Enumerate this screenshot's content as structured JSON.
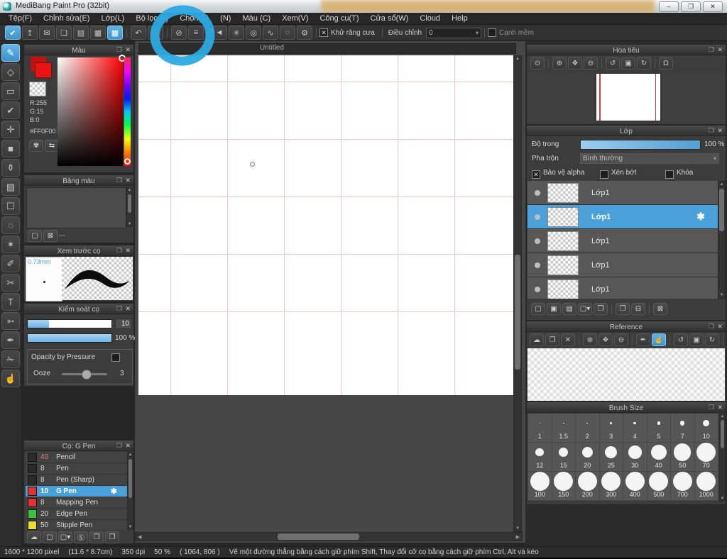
{
  "window": {
    "title": "MediBang Paint Pro (32bit)",
    "controls": [
      "minimize",
      "restore",
      "close-window"
    ]
  },
  "menu": {
    "items": [
      "Tệp(F)",
      "Chỉnh sửa(E)",
      "Lớp(L)",
      "Bộ lọc(R)",
      "Chọn(S)",
      "(N)",
      "Màu (C)",
      "Xem(V)",
      "Công cụ(T)",
      "Cửa sổ(W)",
      "Cloud",
      "Help"
    ]
  },
  "toolbar": {
    "items": [
      {
        "name": "cloud-check",
        "active": true
      },
      "upload",
      "comment",
      "chat",
      "document",
      "list-edit",
      {
        "name": "grid-edit",
        "active": true
      },
      "|",
      "undo",
      "redo",
      "|",
      "no-snap",
      "parallel-snap",
      "|",
      "cross-snap",
      "radial-snap",
      "circle-snap",
      "curve-snap",
      "ellipse-snap",
      "snap-settings"
    ],
    "antialias_label": "Khử răng cưa",
    "adjust_label": "Điều chỉnh",
    "adjust_value": "0",
    "soft_edge_label": "Cạnh mềm"
  },
  "toolbox": {
    "tools": [
      {
        "name": "brush",
        "active": true
      },
      "eraser",
      "shape",
      "polyline",
      "move",
      "fill",
      "bucket",
      "gradient",
      "select",
      "lasso",
      "magic-wand",
      "select-pen",
      "select-eraser",
      "text",
      "operate",
      "eyedropper",
      "div",
      "hand"
    ]
  },
  "color_panel": {
    "title": "Màu",
    "r": "R:255",
    "g": "G:15",
    "b": "B:0",
    "hex": "#FF0F00",
    "buttons": [
      "palette",
      "swap"
    ]
  },
  "palette_panel": {
    "title": "Bảng màu",
    "footer_buttons": [
      "new-item",
      "trash"
    ],
    "footer_text": "---"
  },
  "brush_preview_panel": {
    "title": "Xem trước cọ",
    "size_label": "0.73mm"
  },
  "brush_control_panel": {
    "title": "Kiểm soát cọ",
    "size_value": "10",
    "opacity_value": "100 %",
    "pressure_label": "Opacity by Pressure",
    "ooze_label": "Ooze",
    "ooze_value": "3"
  },
  "brush_list_panel": {
    "title": "Cọ: G Pen",
    "brushes": [
      {
        "size": "40",
        "name": "Pencil",
        "swatch": "#2a2a2a",
        "num_color": "#e57d7d"
      },
      {
        "size": "8",
        "name": "Pen",
        "swatch": "#2a2a2a"
      },
      {
        "size": "8",
        "name": "Pen (Sharp)",
        "swatch": "#2a2a2a"
      },
      {
        "size": "10",
        "name": "G Pen",
        "swatch": "#e23131",
        "selected": true
      },
      {
        "size": "8",
        "name": "Mapping Pen",
        "swatch": "#e23131"
      },
      {
        "size": "20",
        "name": "Edge Pen",
        "swatch": "#35c435"
      },
      {
        "size": "50",
        "name": "Stipple Pen",
        "swatch": "#e8e02c"
      }
    ],
    "footer_buttons": [
      "cloud",
      "new-item",
      "add-menu",
      "script",
      "folder",
      "duplicate"
    ]
  },
  "navigator_panel": {
    "title": "Hoa tiêu",
    "buttons": [
      "zoom-actual",
      "|",
      "zoom-in",
      "zoom-fit",
      "zoom-out",
      "|",
      "rotate-ccw",
      "rotate-reset",
      "rotate-cw",
      "|",
      "lock"
    ]
  },
  "layer_panel": {
    "title": "Lớp",
    "opacity_label": "Độ trong",
    "opacity_value": "100 %",
    "blend_label": "Pha trộn",
    "blend_value": "Bình thường",
    "alpha_label": "Bảo vệ alpha",
    "clip_label": "Xén bớt",
    "lock_label": "Khóa",
    "layers": [
      {
        "name": "Lớp1"
      },
      {
        "name": "Lớp1",
        "selected": true
      },
      {
        "name": "Lớp1"
      },
      {
        "name": "Lớp1"
      },
      {
        "name": "Lớp1"
      }
    ],
    "footer_buttons": [
      "new-item",
      "new-8bit",
      "new-1bit",
      "add-menu",
      "folder",
      "|",
      "duplicate",
      "merge",
      "|",
      "trash"
    ]
  },
  "reference_panel": {
    "title": "Reference",
    "buttons": [
      "cloud",
      "folder",
      "close",
      "|",
      "zoom-in",
      "zoom-fit",
      "zoom-out",
      "|",
      "picker",
      {
        "name": "hand",
        "active": true
      },
      "|",
      "rotate-ccw",
      "rotate-reset",
      "rotate-cw",
      "|",
      "lock"
    ]
  },
  "brush_size_panel": {
    "title": "Brush Size",
    "sizes": [
      "1",
      "1.5",
      "2",
      "3",
      "4",
      "5",
      "7",
      "10",
      "12",
      "15",
      "20",
      "25",
      "30",
      "40",
      "50",
      "70",
      "100",
      "150",
      "200",
      "300",
      "400",
      "500",
      "700",
      "1000"
    ]
  },
  "canvas": {
    "tab_title": "Untitled"
  },
  "status_bar": {
    "segments": [
      "1600 * 1200 pixel",
      "(11.6 * 8.7cm)",
      "350 dpi",
      "50 %",
      "( 1064, 806 )",
      "Vẽ một đường thẳng bằng cách giữ phím Shift, Thay đổi cỡ cọ bằng cách giữ phím Ctrl, Alt và kéo"
    ]
  },
  "colors": {
    "accent": "#4aa0d8",
    "foreground_color": "#ff0f00",
    "annotation": "#2baae2",
    "grid_line": "#f0c6c6"
  },
  "icons": {
    "minimize": "–",
    "restore": "❐",
    "close-window": "✕",
    "cloud-check": "✔",
    "upload": "↥",
    "comment": "✉",
    "chat": "❏",
    "document": "▤",
    "list-edit": "▦",
    "grid-edit": "▩",
    "undo": "↶",
    "redo": "↷",
    "no-snap": "⊘",
    "parallel-snap": "≡",
    "cross-snap": "◄",
    "radial-snap": "✳",
    "circle-snap": "◎",
    "curve-snap": "∿",
    "ellipse-snap": "◌",
    "snap-settings": "⚙",
    "brush": "✎",
    "eraser": "◇",
    "shape": "▭",
    "polyline": "✔",
    "move": "✛",
    "fill": "■",
    "bucket": "⚱",
    "gradient": "▨",
    "select": "☐",
    "lasso": "◌",
    "magic-wand": "✶",
    "select-pen": "✐",
    "select-eraser": "✂",
    "text": "T",
    "operate": "➳",
    "eyedropper": "✒",
    "div": "✁",
    "hand": "☝",
    "zoom-actual": "⊙",
    "zoom-in": "⊕",
    "zoom-fit": "❖",
    "zoom-out": "⊖",
    "rotate-ccw": "↺",
    "rotate-reset": "▣",
    "rotate-cw": "↻",
    "lock": "Ω",
    "cloud": "☁",
    "folder": "❒",
    "close": "✕",
    "picker": "✒",
    "new-item": "▢",
    "new-8bit": "▣",
    "new-1bit": "▤",
    "add-menu": "▢▾",
    "duplicate": "❐",
    "merge": "⊟",
    "trash": "⊠",
    "script": "Ⓢ",
    "palette": "✾",
    "swap": "⇆",
    "popout": "❐",
    "close_panel": "✕",
    "check": "✕",
    "dropdown": "▾",
    "gear": "✱",
    "scroll_up": "▲",
    "scroll_down": "▼",
    "scroll_left": "◀",
    "scroll_right": "▶"
  }
}
